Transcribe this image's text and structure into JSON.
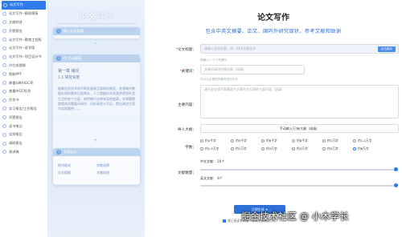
{
  "sidebar": {
    "items": [
      {
        "label": "论文写作",
        "icon": "document-icon",
        "active": true
      },
      {
        "label": "论文写作--精准模板",
        "icon": "template-icon"
      },
      {
        "label": "文献综述",
        "icon": "book-icon"
      },
      {
        "label": "开题报告",
        "icon": "report-icon"
      },
      {
        "label": "论文写作--教育工程版",
        "icon": "graduation-icon"
      },
      {
        "label": "论文写作--医学版",
        "icon": "medical-icon"
      },
      {
        "label": "论文写作--项目设计书",
        "icon": "project-icon"
      },
      {
        "label": "AI生成提纲",
        "icon": "outline-icon"
      },
      {
        "label": "智能PPT",
        "icon": "ppt-icon"
      },
      {
        "label": "降重&降AIGC率",
        "icon": "reduce-icon"
      },
      {
        "label": "查重AIGC检测",
        "icon": "check-icon"
      },
      {
        "label": "任务书",
        "icon": "task-icon"
      },
      {
        "label": "实习报告/工作报告",
        "icon": "work-report-icon"
      },
      {
        "label": "开题报告",
        "icon": "report2-icon"
      },
      {
        "label": "读书笔记",
        "icon": "notes-icon"
      },
      {
        "label": "实践报告",
        "icon": "practice-icon"
      },
      {
        "label": "调研报告",
        "icon": "survey-icon"
      },
      {
        "label": "演讲稿",
        "icon": "speech-icon"
      }
    ]
  },
  "preview": {
    "title": "论文写作",
    "step1": {
      "num": "1",
      "label": "输入论文标题"
    },
    "step2": {
      "num": "2",
      "label": "AI 生成提纲"
    },
    "outline": [
      "第一章 绪论",
      "1.1 研究背景"
    ],
    "outline_text": "随着信息技术的不断发展和互联网的普及，各领域对数据处理的需求日益增长，人工智能技术逐渐渗透到社会生活的各个方面，给传统行业带来深刻变革。本课题围绕相关问题展开研究，分析现状与不足，提出改进方案与实现路径……",
    "step3": {
      "num": "3",
      "label": "生成论文"
    },
    "options": [
      "期刊格式",
      "字数选择",
      "论文提纲",
      "文献综述"
    ]
  },
  "main": {
    "title": "论文写作",
    "subtitle": "包含中英文摘要、正文、国内外研究现状、参考文献和致谢",
    "title_field": {
      "label": "论文标题：",
      "placeholder": "请输入论文标题，如：XXX系统设计",
      "save_btn": "点击保存"
    },
    "keywords": {
      "label": "关键词：",
      "hint": "请输入1~5个关键词",
      "placeholder": "关键词请用空格分隔（选填）",
      "hint2": "可以为文章的关键词进行补充"
    },
    "abstract": {
      "label": "主要内容：",
      "placeholder": "请在此处填写您需要在文章中涉及到的主要内容（选填）"
    },
    "import": {
      "label": "导入大纲：",
      "button": "手动输入/已有大纲（选填）"
    },
    "wordcount": {
      "label": "字数：",
      "options": [
        "约4千字",
        "约5千字",
        "约6千字",
        "约8千字",
        "约1万字",
        "约1.2万字",
        "约1.5万字",
        "约2万字",
        "约3万字",
        "约4万字",
        "约5万字",
        "约6万字"
      ],
      "selected_index": 11
    },
    "sliders": {
      "label": "文献数量：",
      "cn_label": "中文文献： 16个",
      "cn_value": 16,
      "en_label": "英文文献： 4个",
      "en_value": 4
    },
    "generate_button": "立即生成 ➤",
    "agree_text": "我已阅读并同意《论文生成服务协议》"
  },
  "watermark": "掘金技术社区 @ 小木学长"
}
